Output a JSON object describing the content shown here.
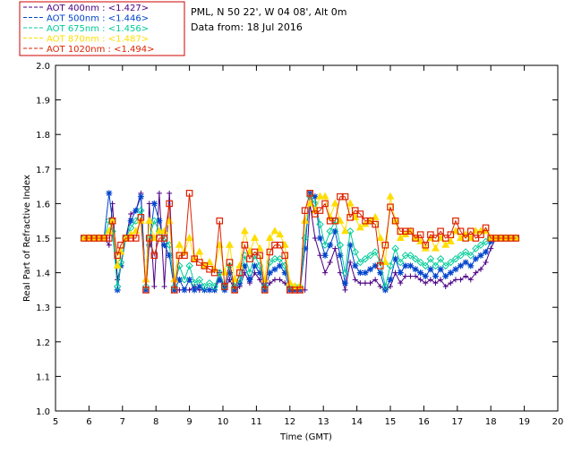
{
  "header": {
    "site": "PML, N 50 22', W 04 08', Alt 0m",
    "date": "Data from: 18 Jul 2016"
  },
  "colors": {
    "axis": "#000000",
    "legend_border": "#cc0000"
  },
  "chart_data": {
    "type": "line",
    "xlabel": "Time (GMT)",
    "ylabel": "Real Part of Refractive Index",
    "xlim": [
      5,
      20
    ],
    "ylim": [
      1.0,
      2.0
    ],
    "xticks": [
      "5",
      "6",
      "7",
      "8",
      "9",
      "10",
      "11",
      "12",
      "13",
      "14",
      "15",
      "16",
      "17",
      "18",
      "19",
      "20"
    ],
    "yticks": [
      "1.0",
      "1.1",
      "1.2",
      "1.3",
      "1.4",
      "1.5",
      "1.6",
      "1.7",
      "1.8",
      "1.9",
      "2.0"
    ],
    "grid": false,
    "legend_position": "top-left (outside plot)",
    "x": [
      5.85,
      6.0,
      6.15,
      6.3,
      6.45,
      6.6,
      6.7,
      6.85,
      6.95,
      7.1,
      7.25,
      7.4,
      7.55,
      7.7,
      7.8,
      7.95,
      8.1,
      8.25,
      8.4,
      8.55,
      8.7,
      8.85,
      9.0,
      9.15,
      9.3,
      9.45,
      9.6,
      9.75,
      9.9,
      10.05,
      10.2,
      10.35,
      10.5,
      10.65,
      10.8,
      10.95,
      11.1,
      11.25,
      11.4,
      11.55,
      11.7,
      11.85,
      12.0,
      12.15,
      12.3,
      12.45,
      12.6,
      12.75,
      12.9,
      13.05,
      13.2,
      13.35,
      13.5,
      13.65,
      13.8,
      13.95,
      14.1,
      14.25,
      14.4,
      14.55,
      14.7,
      14.85,
      15.0,
      15.15,
      15.3,
      15.45,
      15.6,
      15.75,
      15.9,
      16.05,
      16.2,
      16.35,
      16.5,
      16.65,
      16.8,
      16.95,
      17.1,
      17.25,
      17.4,
      17.55,
      17.7,
      17.85,
      18.0,
      18.15,
      18.3,
      18.45,
      18.6,
      18.75
    ],
    "series": [
      {
        "name": "AOT  400nm : <1.427>",
        "color": "#4b0082",
        "marker": "plus",
        "values": [
          1.5,
          1.5,
          1.5,
          1.5,
          1.5,
          1.48,
          1.6,
          1.38,
          1.42,
          1.5,
          1.57,
          1.58,
          1.63,
          1.35,
          1.6,
          1.36,
          1.63,
          1.36,
          1.63,
          1.35,
          1.35,
          1.35,
          1.35,
          1.36,
          1.35,
          1.35,
          1.35,
          1.35,
          1.4,
          1.35,
          1.38,
          1.35,
          1.36,
          1.4,
          1.37,
          1.4,
          1.38,
          1.35,
          1.37,
          1.38,
          1.38,
          1.37,
          1.35,
          1.35,
          1.35,
          1.35,
          1.6,
          1.5,
          1.45,
          1.4,
          1.43,
          1.47,
          1.4,
          1.35,
          1.43,
          1.38,
          1.37,
          1.37,
          1.37,
          1.38,
          1.36,
          1.35,
          1.36,
          1.4,
          1.37,
          1.39,
          1.39,
          1.39,
          1.38,
          1.37,
          1.38,
          1.37,
          1.38,
          1.36,
          1.37,
          1.38,
          1.38,
          1.39,
          1.38,
          1.4,
          1.41,
          1.43,
          1.47,
          1.5,
          1.5,
          1.5,
          1.5,
          1.5
        ]
      },
      {
        "name": "AOT  500nm : <1.446>",
        "color": "#0044cc",
        "marker": "star",
        "values": [
          1.5,
          1.5,
          1.5,
          1.5,
          1.5,
          1.63,
          1.55,
          1.35,
          1.42,
          1.5,
          1.55,
          1.58,
          1.62,
          1.35,
          1.48,
          1.6,
          1.55,
          1.48,
          1.45,
          1.35,
          1.38,
          1.35,
          1.38,
          1.35,
          1.36,
          1.35,
          1.35,
          1.35,
          1.38,
          1.35,
          1.4,
          1.35,
          1.37,
          1.42,
          1.38,
          1.42,
          1.4,
          1.35,
          1.4,
          1.41,
          1.42,
          1.4,
          1.35,
          1.35,
          1.35,
          1.47,
          1.63,
          1.62,
          1.5,
          1.45,
          1.48,
          1.52,
          1.45,
          1.37,
          1.48,
          1.42,
          1.4,
          1.4,
          1.41,
          1.42,
          1.4,
          1.35,
          1.38,
          1.44,
          1.4,
          1.42,
          1.42,
          1.41,
          1.4,
          1.39,
          1.41,
          1.39,
          1.41,
          1.39,
          1.4,
          1.41,
          1.42,
          1.43,
          1.42,
          1.44,
          1.45,
          1.46,
          1.49,
          1.5,
          1.5,
          1.5,
          1.5,
          1.5
        ]
      },
      {
        "name": "AOT  675nm : <1.456>",
        "color": "#00cc99",
        "marker": "diamond",
        "values": [
          1.5,
          1.5,
          1.5,
          1.5,
          1.5,
          1.55,
          1.52,
          1.36,
          1.43,
          1.5,
          1.53,
          1.55,
          1.58,
          1.36,
          1.5,
          1.55,
          1.52,
          1.5,
          1.48,
          1.36,
          1.42,
          1.38,
          1.42,
          1.37,
          1.38,
          1.36,
          1.37,
          1.36,
          1.4,
          1.36,
          1.42,
          1.36,
          1.38,
          1.45,
          1.4,
          1.45,
          1.42,
          1.36,
          1.43,
          1.44,
          1.44,
          1.42,
          1.36,
          1.36,
          1.36,
          1.5,
          1.62,
          1.6,
          1.54,
          1.48,
          1.52,
          1.55,
          1.48,
          1.4,
          1.52,
          1.46,
          1.43,
          1.44,
          1.45,
          1.46,
          1.43,
          1.36,
          1.42,
          1.47,
          1.43,
          1.45,
          1.45,
          1.44,
          1.43,
          1.42,
          1.44,
          1.42,
          1.44,
          1.42,
          1.43,
          1.44,
          1.45,
          1.46,
          1.45,
          1.47,
          1.48,
          1.49,
          1.5,
          1.5,
          1.5,
          1.5,
          1.5,
          1.5
        ]
      },
      {
        "name": "AOT  870nm : <1.487>",
        "color": "#ffdd00",
        "marker": "triangle",
        "values": [
          1.5,
          1.5,
          1.5,
          1.5,
          1.5,
          1.52,
          1.55,
          1.42,
          1.46,
          1.5,
          1.51,
          1.52,
          1.55,
          1.38,
          1.55,
          1.5,
          1.52,
          1.52,
          1.55,
          1.38,
          1.48,
          1.46,
          1.5,
          1.44,
          1.46,
          1.42,
          1.43,
          1.41,
          1.48,
          1.4,
          1.48,
          1.38,
          1.42,
          1.52,
          1.46,
          1.5,
          1.47,
          1.38,
          1.5,
          1.52,
          1.51,
          1.48,
          1.37,
          1.36,
          1.36,
          1.55,
          1.6,
          1.58,
          1.62,
          1.62,
          1.56,
          1.6,
          1.55,
          1.52,
          1.6,
          1.56,
          1.53,
          1.54,
          1.55,
          1.56,
          1.5,
          1.43,
          1.62,
          1.55,
          1.5,
          1.51,
          1.52,
          1.5,
          1.49,
          1.47,
          1.5,
          1.47,
          1.5,
          1.48,
          1.49,
          1.52,
          1.5,
          1.51,
          1.5,
          1.52,
          1.52,
          1.52,
          1.5,
          1.5,
          1.5,
          1.5,
          1.5,
          1.5
        ]
      },
      {
        "name": "AOT 1020nm : <1.494>",
        "color": "#dd2200",
        "marker": "square",
        "values": [
          1.5,
          1.5,
          1.5,
          1.5,
          1.5,
          1.5,
          1.55,
          1.45,
          1.48,
          1.5,
          1.5,
          1.5,
          1.56,
          1.35,
          1.5,
          1.45,
          1.5,
          1.5,
          1.6,
          1.35,
          1.45,
          1.45,
          1.63,
          1.44,
          1.43,
          1.42,
          1.41,
          1.4,
          1.55,
          1.36,
          1.43,
          1.35,
          1.4,
          1.48,
          1.44,
          1.46,
          1.45,
          1.35,
          1.46,
          1.48,
          1.48,
          1.45,
          1.35,
          1.35,
          1.35,
          1.58,
          1.63,
          1.57,
          1.58,
          1.6,
          1.55,
          1.55,
          1.62,
          1.62,
          1.56,
          1.58,
          1.57,
          1.55,
          1.55,
          1.54,
          1.42,
          1.48,
          1.59,
          1.55,
          1.52,
          1.52,
          1.52,
          1.5,
          1.51,
          1.48,
          1.51,
          1.5,
          1.52,
          1.5,
          1.51,
          1.55,
          1.52,
          1.5,
          1.52,
          1.5,
          1.51,
          1.53,
          1.5,
          1.5,
          1.5,
          1.5,
          1.5,
          1.5
        ]
      }
    ]
  }
}
